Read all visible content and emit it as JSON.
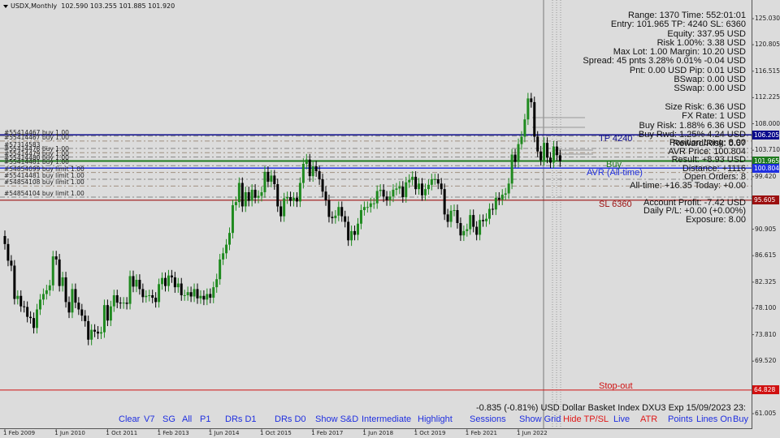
{
  "header": {
    "symbol": "USDX,Monthly",
    "ohlc": "102.590 103.255 101.885 101.920"
  },
  "info_top": [
    "Range: 1370 Time: 552:01:01",
    "Entry: 101.965 TP: 4240 SL: 6360",
    "Equity: 337.95 USD",
    "Risk 1.00%: 3.38 USD",
    "Max Lot: 1.00 Margin: 10.20 USD",
    "Spread: 45 pnts 3.28% 0.01% -0.04 USD",
    "Pnt: 0.00 USD Pip: 0.01 USD",
    "BSwap:  0.00 USD",
    "SSwap:  0.00 USD",
    "",
    "Size Risk: 6.36 USD",
    "FX Rate: 1 USD",
    "Buy Risk: 1.88% 6.36 USD",
    "Buy Rwd: 1.25% 4.24 USD",
    "Reward/Risk: 0.67"
  ],
  "info_position": [
    "Position Long: 8.00",
    "AVR Price: 100.804",
    "Result: +8.93 USD",
    "Distance: +1116",
    "Open Orders: 8",
    "All-time: +16.35 Today: +0.00",
    "",
    "Account Profit: -7.42 USD",
    "Daily P/L: +0.00 (+0.00%)",
    "Exposure: 8.00"
  ],
  "line_labels": {
    "tp": "TP 4240",
    "buy": "Buy",
    "avr": "AVR (All-time)",
    "sl": "SL 6360",
    "stopout": "Stop-out"
  },
  "order_labels": [
    {
      "text": "#55414467 buy 1.00",
      "price": 106.0
    },
    {
      "text": "#55414467 buy 1.00",
      "price": 105.2
    },
    {
      "text": "#57314583 ...",
      "price": 104.0
    },
    {
      "text": "#55414478 buy 1.00",
      "price": 103.3
    },
    {
      "text": "#55414479 buy 1.00",
      "price": 102.6
    },
    {
      "text": "#55414480 buy 1.00",
      "price": 101.9
    },
    {
      "text": "#55414481 buy 1.00",
      "price": 101.2
    },
    {
      "text": "#54854099 buy limit 1.00",
      "price": 100.1
    },
    {
      "text": "#55414481 buy limit 1.00",
      "price": 99.0
    },
    {
      "text": "#54854108 buy limit 1.00",
      "price": 97.9
    },
    {
      "text": "#54854104 buy limit 1.00",
      "price": 96.1
    }
  ],
  "levels": {
    "tp": 106.205,
    "entry": 101.965,
    "avr": 100.804,
    "sl": 95.605,
    "stopout": 64.828
  },
  "colors": {
    "tp": "#0a0a8c",
    "entry": "#1e7a1e",
    "avr": "#1f2fe0",
    "sl": "#9c1010",
    "stopout": "#d01010",
    "bull": "#1f8a1f",
    "bear": "#000000",
    "button": "#1f2fe0",
    "button_alert": "#e01818"
  },
  "status": "-0.835 (-0.81%) USD Dollar Basket Index DXU3 Exp 15/09/2023 23:",
  "buttons": [
    {
      "label": "Clear",
      "alert": false
    },
    {
      "label": "V7",
      "alert": false
    },
    {
      "label": "SG",
      "alert": false
    },
    {
      "label": "All",
      "alert": false
    },
    {
      "label": "P1",
      "alert": false
    },
    {
      "label": "DRs D1",
      "alert": false
    },
    {
      "label": "DRs D0",
      "alert": false
    },
    {
      "label": "Show S&D",
      "alert": false
    },
    {
      "label": "Intermediate",
      "alert": false
    },
    {
      "label": "Highlight",
      "alert": false
    },
    {
      "label": "Sessions",
      "alert": false
    },
    {
      "label": "Show Grid",
      "alert": false
    },
    {
      "label": "Hide TP/SL",
      "alert": true
    },
    {
      "label": "Live",
      "alert": false
    },
    {
      "label": "ATR",
      "alert": true
    },
    {
      "label": "Points",
      "alert": false
    },
    {
      "label": "Lines On",
      "alert": false
    },
    {
      "label": "Buy",
      "alert": false
    }
  ],
  "chart_data": {
    "type": "candlestick",
    "title": "USDX,Monthly",
    "timeframe": "Monthly",
    "start": "2009-02",
    "ylim": [
      61.005,
      125.03
    ],
    "y_ticks": [
      "125.030",
      "120.805",
      "116.515",
      "112.225",
      "108.000",
      "103.710",
      "99.420",
      "90.905",
      "86.615",
      "82.325",
      "78.100",
      "73.810",
      "69.520",
      "61.005"
    ],
    "y_price_boxes": [
      "106.205",
      "101.965",
      "100.804",
      "95.605",
      "64.828"
    ],
    "x_ticks": [
      "1 Feb 2009",
      "1 Jun 2010",
      "1 Oct 2011",
      "1 Feb 2013",
      "1 Jun 2014",
      "1 Oct 2015",
      "1 Feb 2017",
      "1 Jun 2018",
      "1 Oct 2019",
      "1 Feb 2021",
      "1 Jun 2022"
    ],
    "grid": false,
    "closes": [
      88.5,
      85.8,
      85.0,
      79.6,
      80.1,
      78.4,
      78.3,
      76.7,
      76.5,
      74.9,
      77.9,
      79.5,
      80.4,
      81.0,
      81.8,
      86.5,
      86.0,
      81.7,
      83.1,
      79.1,
      77.4,
      81.2,
      79.0,
      77.9,
      76.9,
      76.0,
      73.0,
      74.6,
      74.3,
      74.0,
      74.2,
      78.6,
      76.1,
      78.4,
      80.2,
      79.0,
      78.9,
      79.0,
      78.8,
      83.3,
      81.6,
      82.7,
      81.2,
      79.9,
      80.1,
      80.2,
      79.8,
      79.1,
      82.0,
      83.0,
      81.7,
      83.4,
      83.1,
      81.5,
      82.1,
      80.2,
      80.2,
      80.7,
      80.0,
      81.2,
      79.7,
      80.1,
      79.5,
      80.4,
      79.8,
      81.5,
      82.8,
      86.0,
      87.0,
      88.4,
      90.3,
      94.8,
      95.3,
      98.4,
      94.6,
      96.9,
      95.5,
      97.3,
      96.0,
      96.3,
      96.9,
      100.2,
      98.6,
      99.6,
      98.2,
      94.6,
      93.0,
      95.9,
      96.1,
      95.5,
      96.0,
      95.4,
      98.4,
      101.5,
      102.2,
      99.5,
      101.1,
      100.3,
      99.0,
      97.0,
      95.6,
      92.9,
      92.7,
      93.1,
      94.5,
      93.0,
      92.1,
      89.1,
      90.6,
      90.0,
      91.8,
      94.0,
      94.5,
      94.5,
      95.1,
      95.1,
      97.1,
      97.3,
      96.2,
      95.6,
      96.2,
      97.3,
      97.5,
      97.8,
      96.1,
      98.5,
      98.9,
      99.4,
      97.4,
      98.3,
      96.4,
      97.4,
      98.1,
      99.0,
      99.0,
      98.3,
      97.4,
      93.3,
      92.1,
      93.9,
      94.0,
      91.9,
      89.9,
      90.6,
      90.9,
      93.2,
      91.3,
      90.0,
      92.4,
      92.2,
      92.6,
      94.2,
      94.1,
      96.0,
      95.7,
      96.5,
      96.7,
      98.3,
      103.0,
      101.8,
      104.7,
      105.9,
      108.7,
      112.1,
      111.5,
      105.9,
      103.5,
      102.1,
      104.9,
      102.5,
      101.7,
      104.3,
      102.9,
      101.9
    ]
  }
}
